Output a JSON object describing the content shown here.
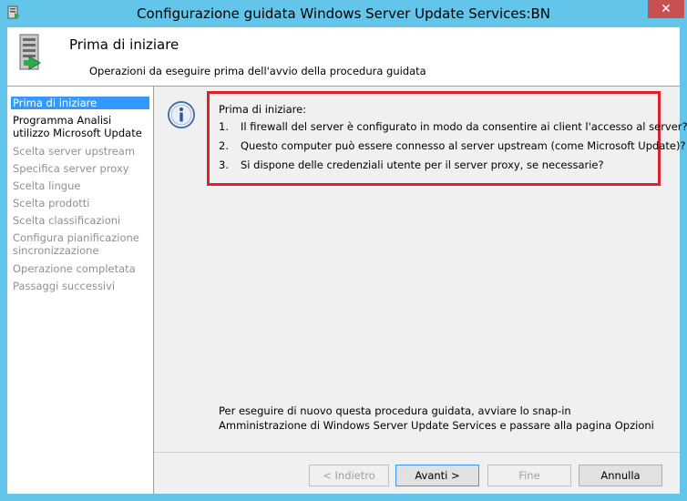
{
  "window": {
    "title": "Configurazione guidata Windows Server Update Services:BN",
    "close_label": "✕"
  },
  "header": {
    "title": "Prima di iniziare",
    "subtitle": "Operazioni da eseguire prima dell'avvio della procedura guidata"
  },
  "sidebar": {
    "items": [
      {
        "label": "Prima di iniziare",
        "state": "active"
      },
      {
        "label": "Programma Analisi utilizzo Microsoft Update",
        "state": "enabled"
      },
      {
        "label": "Scelta server upstream",
        "state": "disabled"
      },
      {
        "label": "Specifica server proxy",
        "state": "disabled"
      },
      {
        "label": "Scelta lingue",
        "state": "disabled"
      },
      {
        "label": "Scelta prodotti",
        "state": "disabled"
      },
      {
        "label": "Scelta classificazioni",
        "state": "disabled"
      },
      {
        "label": "Configura pianificazione sincronizzazione",
        "state": "disabled"
      },
      {
        "label": "Operazione completata",
        "state": "disabled"
      },
      {
        "label": "Passaggi successivi",
        "state": "disabled"
      }
    ]
  },
  "main": {
    "checklist_title": "Prima di iniziare:",
    "checklist": [
      {
        "num": "1.",
        "text": "Il firewall del server è configurato in modo da consentire ai client l'accesso al server?"
      },
      {
        "num": "2.",
        "text": "Questo computer può essere connesso al server upstream (come Microsoft Update)?"
      },
      {
        "num": "3.",
        "text": "Si dispone delle credenziali utente per il server proxy, se necessarie?"
      }
    ],
    "footer_text": "Per eseguire di nuovo questa procedura guidata, avviare lo snap-in Amministrazione di Windows Server Update Services e passare alla pagina Opzioni"
  },
  "buttons": {
    "back": "< Indietro",
    "next": "Avanti >",
    "finish": "Fine",
    "cancel": "Annulla"
  },
  "colors": {
    "titlebar": "#63c5ea",
    "highlight": "#3399ff",
    "callout_border": "#e0202a",
    "close_button": "#c75050"
  }
}
